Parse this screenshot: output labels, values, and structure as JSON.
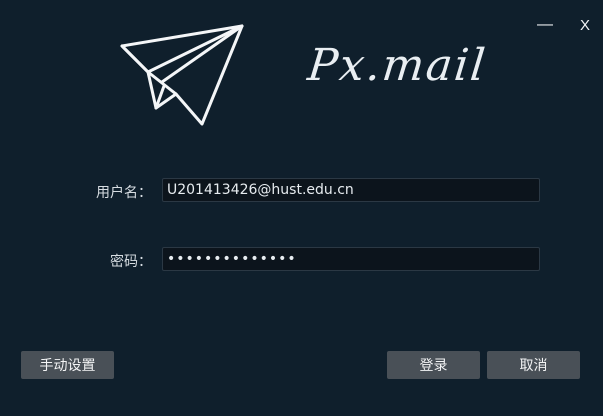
{
  "window": {
    "minimize_label": "—",
    "close_label": "X"
  },
  "brand": {
    "name": "Px.mail"
  },
  "login_form": {
    "username_label": "用户名：",
    "username_value": "U201413426@hust.edu.cn",
    "password_label": "密码：",
    "password_value": "••••••••••••••"
  },
  "buttons": {
    "manual_settings": "手动设置",
    "login": "登录",
    "cancel": "取消"
  },
  "colors": {
    "background": "#0f1f2c",
    "input_background": "#0c141c",
    "button": "#495057",
    "text": "#dfe6ec"
  },
  "icons": {
    "logo": "paper-plane-icon"
  }
}
